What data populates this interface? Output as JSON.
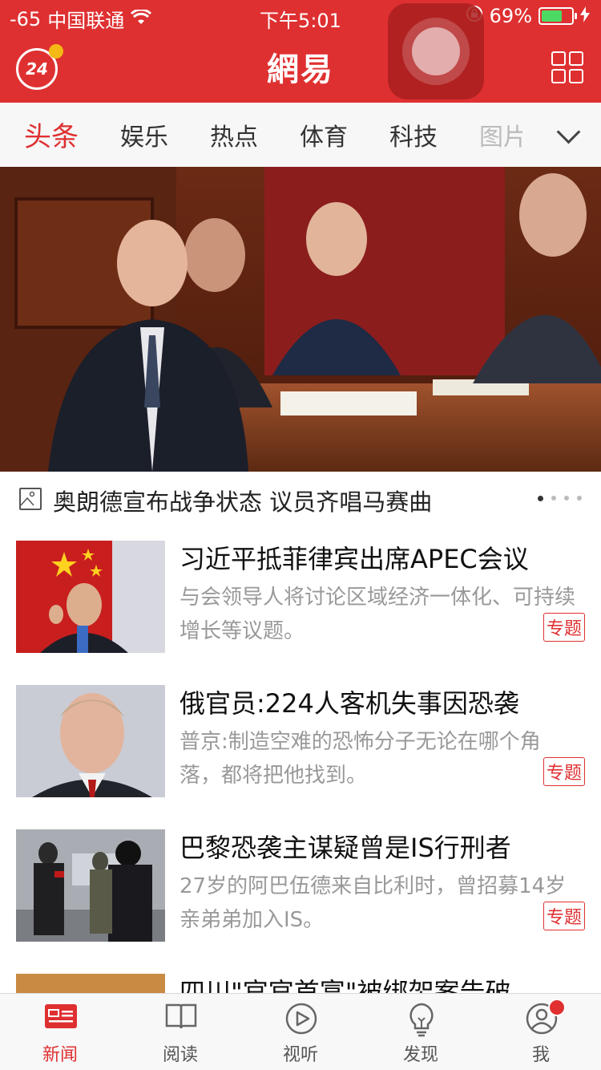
{
  "status_bar": {
    "signal": "-65",
    "carrier": "中国联通",
    "time": "下午5:01",
    "battery_percent": "69%",
    "battery_level": 0.69,
    "battery_color": "#4cd964"
  },
  "header": {
    "brand": "網易",
    "logo_badge": "24",
    "accent_color": "#df3031",
    "icons": [
      "wifi-icon",
      "lock-rotation-icon",
      "charging-icon",
      "grid-menu-icon",
      "assistive-touch-icon"
    ]
  },
  "tabs": [
    {
      "label": "头条",
      "active": true
    },
    {
      "label": "娱乐"
    },
    {
      "label": "热点"
    },
    {
      "label": "体育"
    },
    {
      "label": "科技"
    },
    {
      "label": "图片"
    }
  ],
  "hero": {
    "caption": "奥朗德宣布战争状态 议员齐唱马赛曲",
    "slides": 4,
    "active_slide": 1
  },
  "news": [
    {
      "title": "习近平抵菲律宾出席APEC会议",
      "summary": "与会领导人将讨论区域经济一体化、可持续增长等议题。",
      "tag": "专题"
    },
    {
      "title": "俄官员:224人客机失事因恐袭",
      "summary": "普京:制造空难的恐怖分子无论在哪个角落，都将把他找到。",
      "tag": "专题"
    },
    {
      "title": "巴黎恐袭主谋疑曾是IS行刑者",
      "summary": "27岁的阿巴伍德来自比利时，曾招募14岁亲弟弟加入IS。",
      "tag": "专题"
    },
    {
      "title": "四川\"官官首富\"被绑架案告破",
      "summary": "",
      "tag": ""
    }
  ],
  "bottom_tabs": [
    {
      "label": "新闻",
      "icon": "newspaper-icon",
      "active": true
    },
    {
      "label": "阅读",
      "icon": "book-icon"
    },
    {
      "label": "视听",
      "icon": "play-icon"
    },
    {
      "label": "发现",
      "icon": "lightbulb-icon"
    },
    {
      "label": "我",
      "icon": "profile-icon",
      "badge": true
    }
  ]
}
